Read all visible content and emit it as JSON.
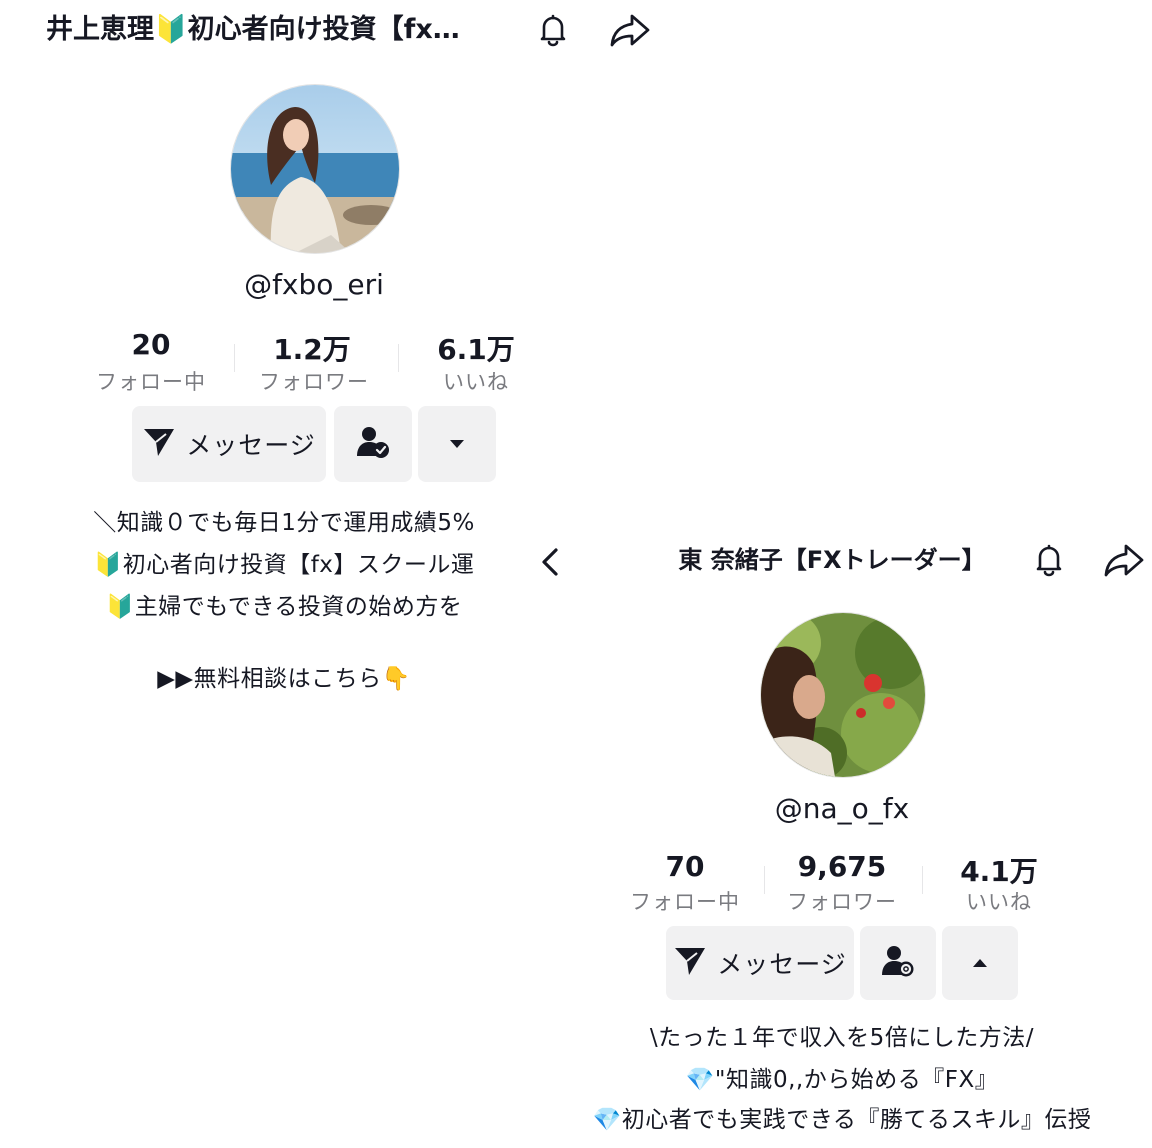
{
  "profile1": {
    "title": "井上恵理🔰初心者向け投資【fx…",
    "handle": "@fxbo_eri",
    "stats": [
      {
        "value": "20",
        "label": "フォロー中"
      },
      {
        "value": "1.2万",
        "label": "フォロワー"
      },
      {
        "value": "6.1万",
        "label": "いいね"
      }
    ],
    "message_button": "メッセージ",
    "icons": {
      "bell": "bell-icon",
      "share": "share-icon",
      "friend": "user-check-icon",
      "dropdown": "caret-down-icon",
      "send": "send-icon"
    },
    "bio": [
      "＼知識０でも毎日1分で運用成績5%",
      "🔰初心者向け投資【fx】スクール運",
      "🔰主婦でもできる投資の始め方を",
      "",
      "▶▶無料相談はこちら👇"
    ]
  },
  "profile2": {
    "title": "東 奈緒子【FXトレーダー】",
    "handle": "@na_o_fx",
    "stats": [
      {
        "value": "70",
        "label": "フォロー中"
      },
      {
        "value": "9,675",
        "label": "フォロワー"
      },
      {
        "value": "4.1万",
        "label": "いいね"
      }
    ],
    "message_button": "メッセージ",
    "icons": {
      "back": "chevron-left-icon",
      "bell": "bell-icon",
      "share": "share-icon",
      "friend": "user-settings-icon",
      "dropdown": "caret-up-icon",
      "send": "send-icon"
    },
    "bio": [
      "\\たった１年で収入を5倍にした方法/",
      "💎\"知識0,,から始める『FX』",
      "💎初心者でも実践できる『勝てるスキル』伝授"
    ]
  },
  "colors": {
    "text": "#161823",
    "secondary": "#7a7b80",
    "button_bg": "#f1f1f2"
  }
}
